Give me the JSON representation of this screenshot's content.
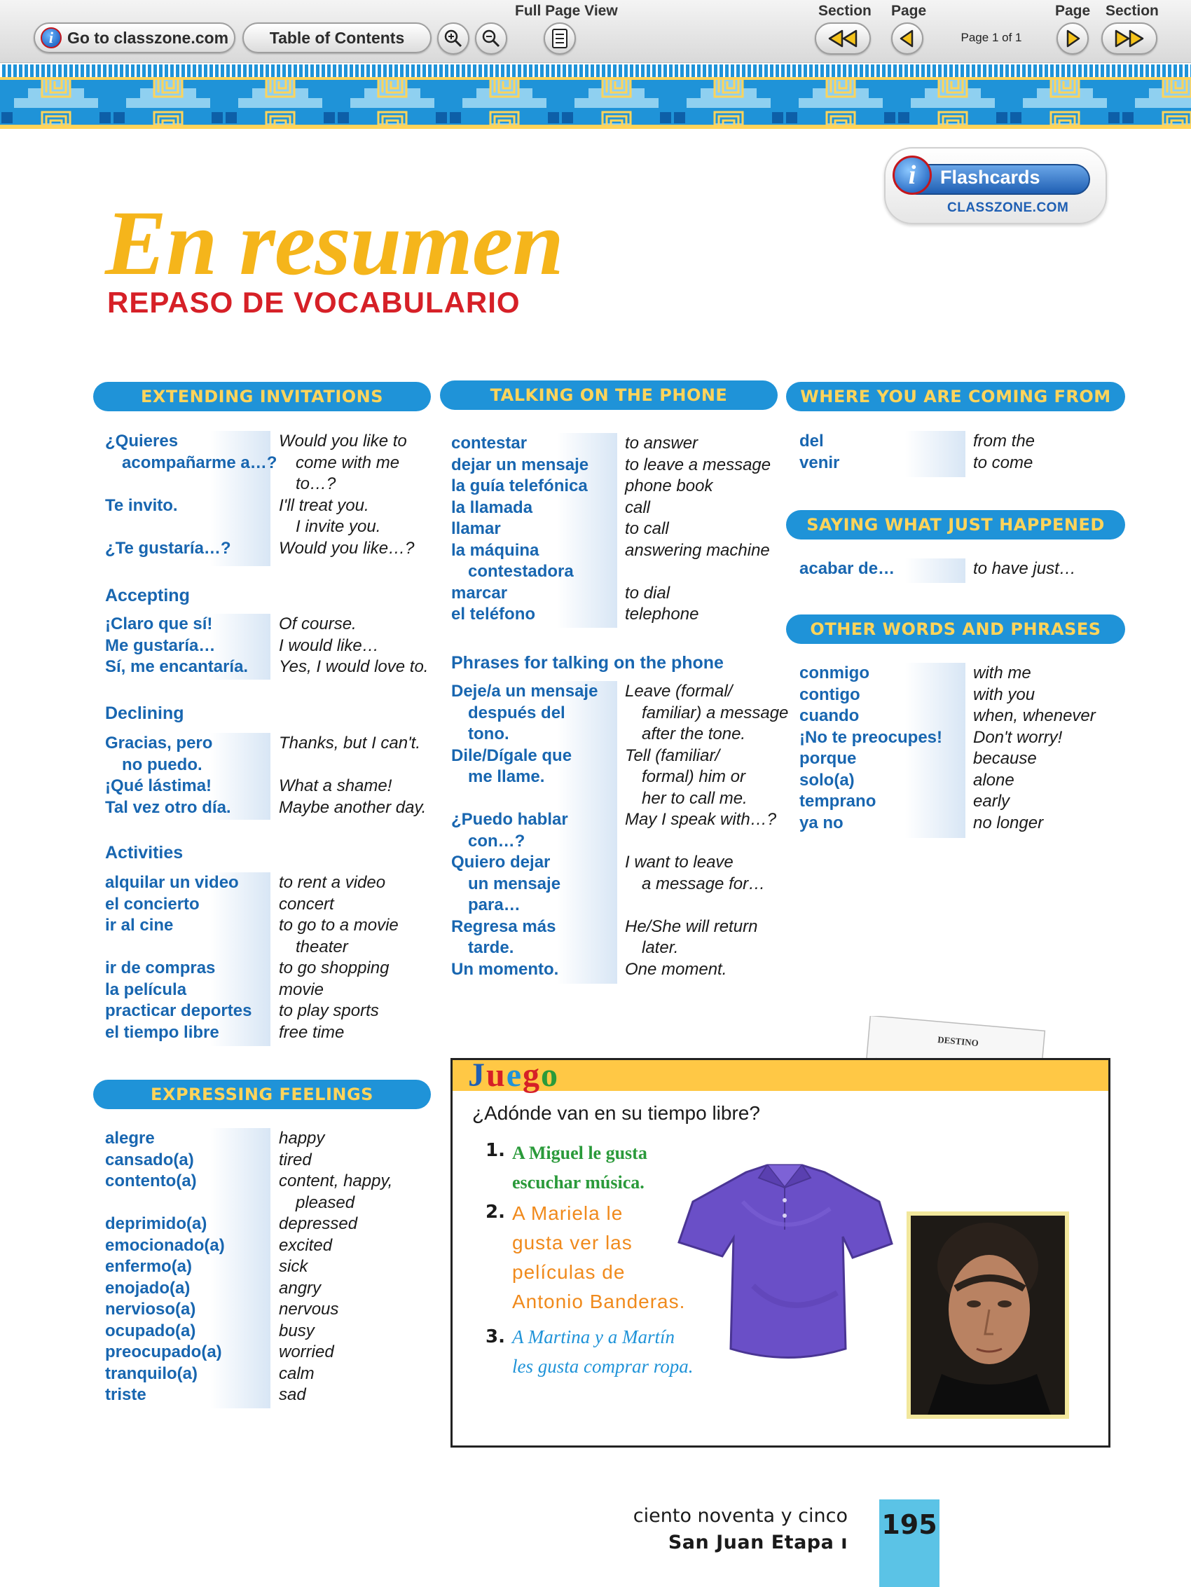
{
  "toolbar": {
    "goto_label": "Go to classzone.com",
    "toc_label": "Table of Contents",
    "full_page_label": "Full Page View",
    "section_label": "Section",
    "page_label": "Page",
    "page_info": "Page 1 of 1"
  },
  "flashcards": {
    "label": "Flashcards",
    "sub": "CLASSZONE.COM",
    "logo_letter": "i"
  },
  "header": {
    "title": "En resumen",
    "subtitle": "REPASO DE VOCABULARIO"
  },
  "sections": {
    "invitations": {
      "title": "EXTENDING INVITATIONS",
      "rows": [
        {
          "es": "¿Quieres",
          "en": "Would you like to"
        },
        {
          "es": "acompañarme a…?",
          "en": "come with me",
          "ind_es": true,
          "ind_en": true
        },
        {
          "es": "",
          "en": "to…?",
          "ind_en": true
        },
        {
          "es": "Te invito.",
          "en": "I'll treat you."
        },
        {
          "es": "",
          "en": "I invite you.",
          "ind_en": true
        },
        {
          "es": "¿Te gustaría…?",
          "en": "Would you like…?"
        }
      ]
    },
    "accepting": {
      "title": "Accepting",
      "rows": [
        {
          "es": "¡Claro que sí!",
          "en": "Of course."
        },
        {
          "es": "Me gustaría…",
          "en": "I would like…"
        },
        {
          "es": "Sí, me encantaría.",
          "en": "Yes, I would love to."
        }
      ]
    },
    "declining": {
      "title": "Declining",
      "rows": [
        {
          "es": "Gracias, pero",
          "en": "Thanks, but I can't."
        },
        {
          "es": "no puedo.",
          "en": "",
          "ind_es": true
        },
        {
          "es": "¡Qué lástima!",
          "en": "What a shame!"
        },
        {
          "es": "Tal vez otro día.",
          "en": "Maybe another day."
        }
      ]
    },
    "activities": {
      "title": "Activities",
      "rows": [
        {
          "es": "alquilar un video",
          "en": "to rent a video"
        },
        {
          "es": "el concierto",
          "en": "concert"
        },
        {
          "es": "ir al cine",
          "en": "to go to a movie"
        },
        {
          "es": "",
          "en": "theater",
          "ind_en": true
        },
        {
          "es": "ir de compras",
          "en": "to go shopping"
        },
        {
          "es": "la película",
          "en": "movie"
        },
        {
          "es": "practicar deportes",
          "en": "to play sports"
        },
        {
          "es": "el tiempo libre",
          "en": "free time"
        }
      ]
    },
    "feelings": {
      "title": "EXPRESSING FEELINGS",
      "rows": [
        {
          "es": "alegre",
          "en": "happy"
        },
        {
          "es": "cansado(a)",
          "en": "tired"
        },
        {
          "es": "contento(a)",
          "en": "content, happy,"
        },
        {
          "es": "",
          "en": "pleased",
          "ind_en": true
        },
        {
          "es": "deprimido(a)",
          "en": "depressed"
        },
        {
          "es": "emocionado(a)",
          "en": "excited"
        },
        {
          "es": "enfermo(a)",
          "en": "sick"
        },
        {
          "es": "enojado(a)",
          "en": "angry"
        },
        {
          "es": "nervioso(a)",
          "en": "nervous"
        },
        {
          "es": "ocupado(a)",
          "en": "busy"
        },
        {
          "es": "preocupado(a)",
          "en": "worried"
        },
        {
          "es": "tranquilo(a)",
          "en": "calm"
        },
        {
          "es": "triste",
          "en": "sad"
        }
      ]
    },
    "phone": {
      "title": "TALKING ON THE PHONE",
      "rows": [
        {
          "es": "contestar",
          "en": "to answer"
        },
        {
          "es": "dejar un mensaje",
          "en": "to leave a message"
        },
        {
          "es": "la guía telefónica",
          "en": "phone book"
        },
        {
          "es": "la llamada",
          "en": "call"
        },
        {
          "es": "llamar",
          "en": "to call"
        },
        {
          "es": "la máquina",
          "en": "answering machine"
        },
        {
          "es": "contestadora",
          "en": "",
          "ind_es": true
        },
        {
          "es": "marcar",
          "en": "to dial"
        },
        {
          "es": "el teléfono",
          "en": "telephone"
        }
      ]
    },
    "phrases": {
      "title": "Phrases for talking on the phone",
      "rows": [
        {
          "es": "Deje/a un mensaje",
          "en": "Leave (formal/"
        },
        {
          "es": "después del",
          "en": "familiar) a message",
          "ind_es": true,
          "ind_en": true
        },
        {
          "es": "tono.",
          "en": "after the tone.",
          "ind_es": true,
          "ind_en": true
        },
        {
          "es": "Dile/Dígale que",
          "en": "Tell (familiar/"
        },
        {
          "es": "me llame.",
          "en": "formal) him or",
          "ind_es": true,
          "ind_en": true
        },
        {
          "es": "",
          "en": "her to call me.",
          "ind_en": true
        },
        {
          "es": "¿Puedo hablar",
          "en": "May I speak with…?"
        },
        {
          "es": "con…?",
          "en": "",
          "ind_es": true
        },
        {
          "es": "Quiero dejar",
          "en": "I want to leave"
        },
        {
          "es": "un mensaje",
          "en": "a message for…",
          "ind_es": true,
          "ind_en": true
        },
        {
          "es": "para…",
          "en": "",
          "ind_es": true
        },
        {
          "es": "Regresa más",
          "en": "He/She will return"
        },
        {
          "es": "tarde.",
          "en": "later.",
          "ind_es": true,
          "ind_en": true
        },
        {
          "es": "Un momento.",
          "en": "One moment."
        }
      ]
    },
    "coming": {
      "title": "WHERE YOU ARE COMING FROM",
      "rows": [
        {
          "es": "del",
          "en": "from the"
        },
        {
          "es": "venir",
          "en": "to come"
        }
      ]
    },
    "happened": {
      "title": "SAYING WHAT JUST HAPPENED",
      "rows": [
        {
          "es": "acabar de…",
          "en": "to have just…"
        }
      ]
    },
    "other": {
      "title": "OTHER WORDS AND PHRASES",
      "rows": [
        {
          "es": "conmigo",
          "en": "with me"
        },
        {
          "es": "contigo",
          "en": "with you"
        },
        {
          "es": "cuando",
          "en": "when, whenever"
        },
        {
          "es": "¡No te preocupes!",
          "en": "Don't worry!"
        },
        {
          "es": "porque",
          "en": "because"
        },
        {
          "es": "solo(a)",
          "en": "alone"
        },
        {
          "es": "temprano",
          "en": "early"
        },
        {
          "es": "ya no",
          "en": "no longer"
        }
      ]
    }
  },
  "juego": {
    "title_letters": [
      "J",
      "u",
      "e",
      "g",
      "o"
    ],
    "question": "¿Adónde van en su tiempo libre?",
    "items": [
      {
        "num": "1.",
        "lines": [
          "A Miguel le gusta",
          "escuchar música."
        ]
      },
      {
        "num": "2.",
        "lines": [
          "A Mariela le",
          "gusta ver las",
          "películas de",
          "Antonio Banderas."
        ]
      },
      {
        "num": "3.",
        "lines": [
          "A Martina y a Martín",
          "les gusta comprar ropa."
        ]
      }
    ],
    "sheet_title": "DESTINO"
  },
  "footer": {
    "line1": "ciento noventa y cinco",
    "line2": "San Juan  Etapa ı",
    "page_number": "195"
  },
  "colors": {
    "header_bg": "#1f93d8",
    "header_text": "#ffd45a",
    "spanish": "#1866b0",
    "title": "#f5b51b",
    "subtitle": "#d62027",
    "juego_bar": "#ffc845",
    "page_tab": "#5bc3e6"
  }
}
